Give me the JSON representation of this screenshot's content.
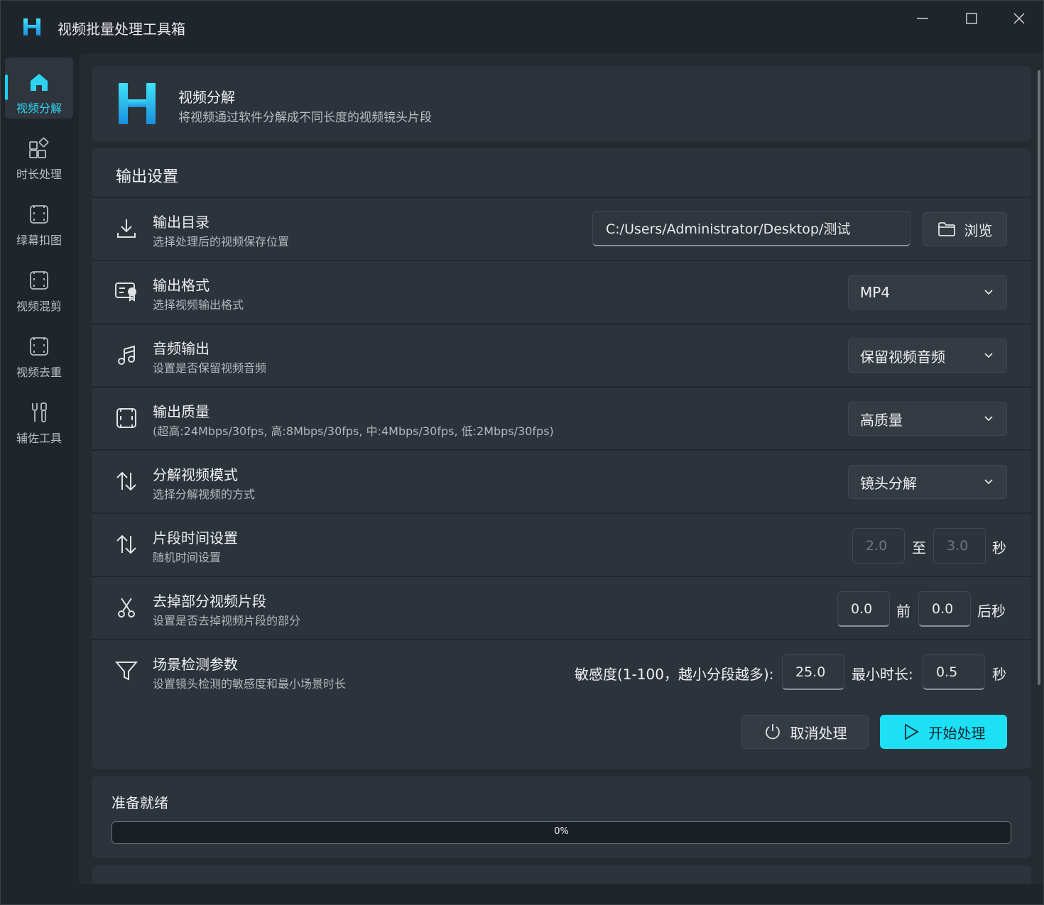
{
  "app": {
    "title": "视频批量处理工具箱"
  },
  "sidebar": {
    "items": [
      {
        "label": "视频分解",
        "icon": "home-icon"
      },
      {
        "label": "时长处理",
        "icon": "apps-icon"
      },
      {
        "label": "绿幕扣图",
        "icon": "film-icon"
      },
      {
        "label": "视频混剪",
        "icon": "film-icon"
      },
      {
        "label": "视频去重",
        "icon": "film-icon"
      },
      {
        "label": "辅佐工具",
        "icon": "tools-icon"
      }
    ],
    "active_index": 0
  },
  "header": {
    "title": "视频分解",
    "subtitle": "将视频通过软件分解成不同长度的视频镜头片段"
  },
  "settings": {
    "title": "输出设置",
    "output_dir": {
      "title": "输出目录",
      "subtitle": "选择处理后的视频保存位置",
      "value": "C:/Users/Administrator/Desktop/测试",
      "browse_label": "浏览"
    },
    "output_format": {
      "title": "输出格式",
      "subtitle": "选择视频输出格式",
      "value": "MP4"
    },
    "audio_output": {
      "title": "音频输出",
      "subtitle": "设置是否保留视频音频",
      "value": "保留视频音频"
    },
    "output_quality": {
      "title": "输出质量",
      "subtitle": "(超高:24Mbps/30fps, 高:8Mbps/30fps, 中:4Mbps/30fps, 低:2Mbps/30fps)",
      "value": "高质量"
    },
    "split_mode": {
      "title": "分解视频模式",
      "subtitle": "选择分解视频的方式",
      "value": "镜头分解"
    },
    "segment_time": {
      "title": "片段时间设置",
      "subtitle": "随机时间设置",
      "min": "2.0",
      "to_label": "至",
      "max": "3.0",
      "unit": "秒"
    },
    "trim": {
      "title": "去掉部分视频片段",
      "subtitle": "设置是否去掉视频片段的部分",
      "front": "0.0",
      "front_label": "前",
      "back": "0.0",
      "back_label": "后秒"
    },
    "scene_detect": {
      "title": "场景检测参数",
      "subtitle": "设置镜头检测的敏感度和最小场景时长",
      "sensitivity_label": "敏感度(1-100，越小分段越多):",
      "sensitivity": "25.0",
      "min_duration_label": "最小时长:",
      "min_duration": "0.5",
      "unit": "秒"
    },
    "cancel_label": "取消处理",
    "start_label": "开始处理"
  },
  "status": {
    "text": "准备就绪",
    "progress": 0,
    "progress_label": "0%"
  },
  "colors": {
    "accent": "#1ee0f5",
    "background": "#20252c",
    "card": "#2d333b"
  }
}
